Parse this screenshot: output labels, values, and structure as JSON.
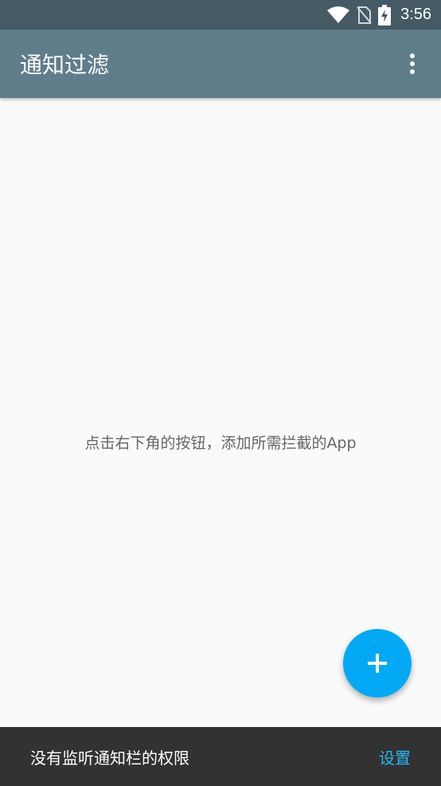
{
  "status_bar": {
    "time": "3:56",
    "icons": [
      "wifi-icon",
      "no-sim-icon",
      "battery-charging-icon"
    ]
  },
  "toolbar": {
    "title": "通知过滤",
    "overflow_icon": "more-vert-icon"
  },
  "content": {
    "empty_hint": "点击右下角的按钮，添加所需拦截的App"
  },
  "fab": {
    "icon": "add-icon"
  },
  "snackbar": {
    "message": "没有监听通知栏的权限",
    "action_label": "设置"
  },
  "colors": {
    "status_bar": "#455a64",
    "toolbar": "#607d8b",
    "background": "#fafafa",
    "fab": "#03a9f4",
    "snackbar": "#323232",
    "snackbar_action": "#29b6f6"
  }
}
